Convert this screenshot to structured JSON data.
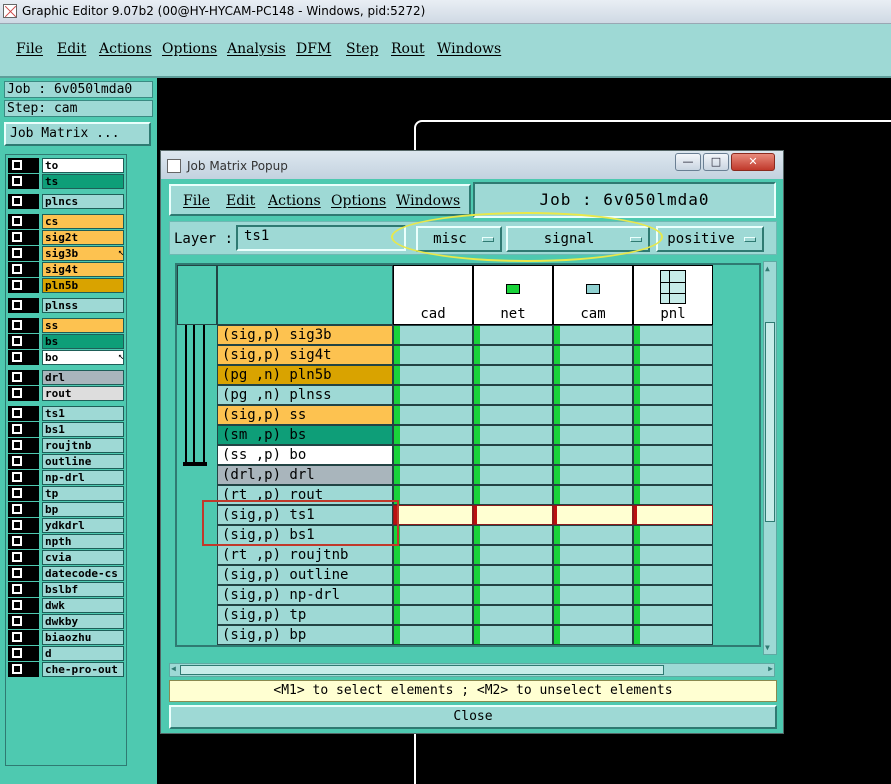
{
  "window": {
    "title": "Graphic Editor 9.07b2 (00@HY-HYCAM-PC148 - Windows, pid:5272)"
  },
  "menu": [
    "File",
    "Edit",
    "Actions",
    "Options",
    "Analysis",
    "DFM",
    "Step",
    "Rout",
    "Windows"
  ],
  "left_panel": {
    "job": "Job : 6v050lmda0",
    "step": "Step: cam",
    "job_matrix_button": "Job Matrix ...",
    "layers": [
      {
        "name": "to",
        "color": "#ffffff"
      },
      {
        "name": "ts",
        "color": "#0e9e78"
      },
      {
        "name": "plncs",
        "color": "#9ed9d5"
      },
      {
        "name": "cs",
        "color": "#fdc250"
      },
      {
        "name": "sig2t",
        "color": "#fdc250"
      },
      {
        "name": "sig3b",
        "color": "#fdc250",
        "arrow": true
      },
      {
        "name": "sig4t",
        "color": "#fdc250"
      },
      {
        "name": "pln5b",
        "color": "#d9a300"
      },
      {
        "name": "plnss",
        "color": "#9ed9d5"
      },
      {
        "name": "ss",
        "color": "#fdc250"
      },
      {
        "name": "bs",
        "color": "#0e9e78"
      },
      {
        "name": "bo",
        "color": "#ffffff",
        "arrow": true
      },
      {
        "name": "drl",
        "color": "#a9b5bc"
      },
      {
        "name": "rout",
        "color": "#dddddd"
      },
      {
        "name": "ts1",
        "color": "#9ed9d5"
      },
      {
        "name": "bs1",
        "color": "#9ed9d5"
      },
      {
        "name": "roujtnb",
        "color": "#9ed9d5"
      },
      {
        "name": "outline",
        "color": "#9ed9d5"
      },
      {
        "name": "np-drl",
        "color": "#9ed9d5"
      },
      {
        "name": "tp",
        "color": "#9ed9d5"
      },
      {
        "name": "bp",
        "color": "#9ed9d5"
      },
      {
        "name": "ydkdrl",
        "color": "#9ed9d5"
      },
      {
        "name": "npth",
        "color": "#9ed9d5"
      },
      {
        "name": "cvia",
        "color": "#9ed9d5"
      },
      {
        "name": "datecode-cs",
        "color": "#9ed9d5"
      },
      {
        "name": "bslbf",
        "color": "#9ed9d5"
      },
      {
        "name": "dwk",
        "color": "#9ed9d5"
      },
      {
        "name": "dwkby",
        "color": "#9ed9d5"
      },
      {
        "name": "biaozhu",
        "color": "#9ed9d5"
      },
      {
        "name": "d",
        "color": "#9ed9d5"
      },
      {
        "name": "che-pro-out",
        "color": "#9ed9d5"
      }
    ]
  },
  "popup": {
    "title": "Job Matrix Popup",
    "menu": [
      "File",
      "Edit",
      "Actions",
      "Options",
      "Windows"
    ],
    "job_label": "Job : 6v050lmda0",
    "layer_label": "Layer :",
    "layer_value": "ts1",
    "context_option": "misc",
    "type_option": "signal",
    "polarity_option": "positive",
    "columns": [
      {
        "name": "cad",
        "icon": "none"
      },
      {
        "name": "net",
        "icon": "green-square-icon"
      },
      {
        "name": "cam",
        "icon": "monitor-icon"
      },
      {
        "name": "pnl",
        "icon": "panel-grid-icon"
      }
    ],
    "rows": [
      {
        "label": "(sig,p) sig3b",
        "color": "#fdc250"
      },
      {
        "label": "(sig,p) sig4t",
        "color": "#fdc250"
      },
      {
        "label": "(pg ,n) pln5b",
        "color": "#d9a300"
      },
      {
        "label": "(pg ,n) plnss",
        "color": "#9ed9d5"
      },
      {
        "label": "(sig,p) ss",
        "color": "#fdc250"
      },
      {
        "label": "(sm ,p) bs",
        "color": "#0e9e78"
      },
      {
        "label": "(ss ,p) bo",
        "color": "#ffffff"
      },
      {
        "label": "(drl,p) drl",
        "color": "#a9b5bc"
      },
      {
        "label": "(rt ,p) rout",
        "color": "#9ed9d5"
      },
      {
        "label": "(sig,p) ts1",
        "color": "#9ed9d5",
        "selected": true
      },
      {
        "label": "(sig,p) bs1",
        "color": "#9ed9d5"
      },
      {
        "label": "(rt ,p) roujtnb",
        "color": "#9ed9d5"
      },
      {
        "label": "(sig,p) outline",
        "color": "#9ed9d5"
      },
      {
        "label": "(sig,p) np-drl",
        "color": "#9ed9d5"
      },
      {
        "label": "(sig,p) tp",
        "color": "#9ed9d5"
      },
      {
        "label": "(sig,p) bp",
        "color": "#9ed9d5"
      }
    ],
    "status": "<M1> to select elements ; <M2> to unselect elements",
    "close_label": "Close"
  }
}
